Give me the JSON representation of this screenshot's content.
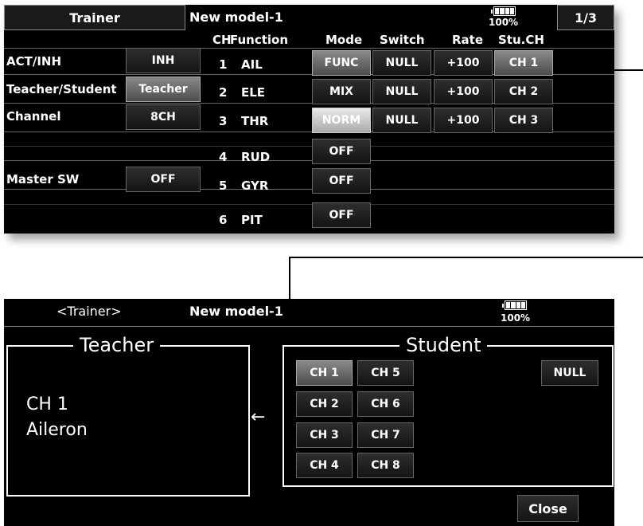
{
  "screen1": {
    "title_tab": "Trainer",
    "model_name": "New model-1",
    "battery": "100%",
    "page": "1/3",
    "settings": [
      {
        "label": "ACT/INH",
        "value": "INH",
        "style": "dark"
      },
      {
        "label": "Teacher/Student",
        "value": "Teacher",
        "style": "hi"
      },
      {
        "label": "Channel",
        "value": "8CH",
        "style": "dark"
      },
      {
        "label": "Master SW",
        "value": "OFF",
        "style": "dark"
      }
    ],
    "headers": {
      "ch": "CH",
      "function": "Function",
      "mode": "Mode",
      "switch": "Switch",
      "rate": "Rate",
      "stu_ch": "Stu.CH"
    },
    "channels": [
      {
        "ch": "1",
        "function": "AIL",
        "mode": "FUNC",
        "mode_style": "hi",
        "switch": "NULL",
        "rate": "+100",
        "stu_ch": "CH 1"
      },
      {
        "ch": "2",
        "function": "ELE",
        "mode": "MIX",
        "mode_style": "dark",
        "switch": "NULL",
        "rate": "+100",
        "stu_ch": "CH 2"
      },
      {
        "ch": "3",
        "function": "THR",
        "mode": "NORM",
        "mode_style": "lite",
        "switch": "NULL",
        "rate": "+100",
        "stu_ch": "CH 3"
      },
      {
        "ch": "4",
        "function": "RUD",
        "mode": "OFF",
        "mode_style": "dark"
      },
      {
        "ch": "5",
        "function": "GYR",
        "mode": "OFF",
        "mode_style": "dark"
      },
      {
        "ch": "6",
        "function": "PIT",
        "mode": "OFF",
        "mode_style": "dark"
      }
    ]
  },
  "screen2": {
    "title": "<Trainer>",
    "model_name": "New model-1",
    "battery": "100%",
    "teacher_title": "Teacher",
    "teacher_ch": "CH 1",
    "teacher_function": "Aileron",
    "student_title": "Student",
    "student_channels": [
      "CH 1",
      "CH 5",
      "CH 2",
      "CH 6",
      "CH 3",
      "CH 7",
      "CH 4",
      "CH 8"
    ],
    "null_button": "NULL",
    "close_button": "Close"
  }
}
